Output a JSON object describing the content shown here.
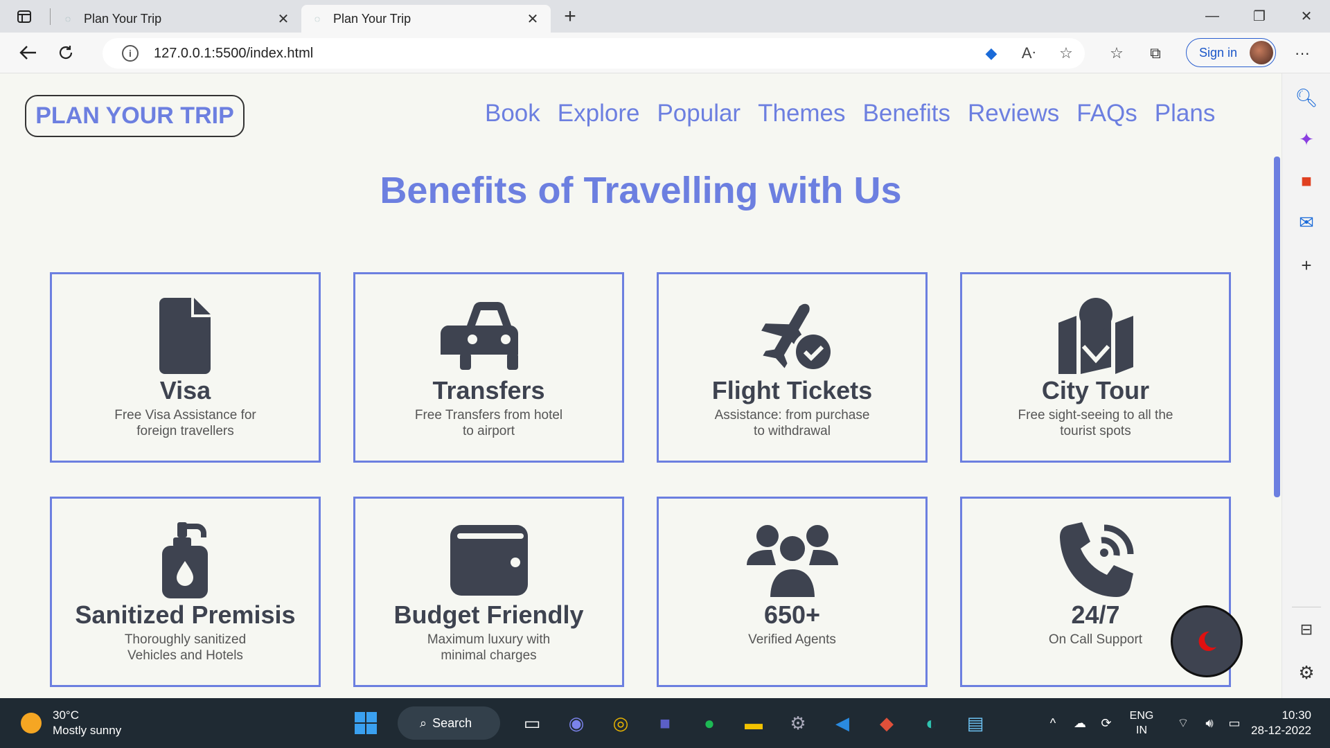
{
  "browser": {
    "tabs": [
      {
        "title": "Plan Your Trip",
        "active": false
      },
      {
        "title": "Plan Your Trip",
        "active": true
      }
    ],
    "url": "127.0.0.1:5500/index.html",
    "sign_in": "Sign in"
  },
  "site": {
    "brand": "PLAN YOUR TRIP",
    "nav": [
      "Book",
      "Explore",
      "Popular",
      "Themes",
      "Benefits",
      "Reviews",
      "FAQs",
      "Plans"
    ],
    "section_title": "Benefits of Travelling with Us",
    "cards": [
      {
        "icon": "file-icon",
        "title": "Visa",
        "desc": "Free Visa Assistance for foreign travellers"
      },
      {
        "icon": "car-icon",
        "title": "Transfers",
        "desc": "Free Transfers from hotel to airport"
      },
      {
        "icon": "plane-check-icon",
        "title": "Flight Tickets",
        "desc": "Assistance: from purchase to withdrawal"
      },
      {
        "icon": "map-location-icon",
        "title": "City Tour",
        "desc": "Free sight-seeing to all the tourist spots"
      },
      {
        "icon": "soap-pump-icon",
        "title": "Sanitized Premisis",
        "desc": "Thoroughly sanitized Vehicles and Hotels"
      },
      {
        "icon": "wallet-icon",
        "title": "Budget Friendly",
        "desc": "Maximum luxury with minimal charges"
      },
      {
        "icon": "users-icon",
        "title": "650+",
        "desc": "Verified Agents"
      },
      {
        "icon": "phone-volume-icon",
        "title": "24/7",
        "desc": "On Call Support"
      }
    ],
    "accent_color": "#6c7fe0"
  },
  "taskbar": {
    "weather_temp": "30°C",
    "weather_desc": "Mostly sunny",
    "search_label": "Search",
    "lang_top": "ENG",
    "lang_bottom": "IN",
    "time": "10:30",
    "date": "28-12-2022"
  }
}
